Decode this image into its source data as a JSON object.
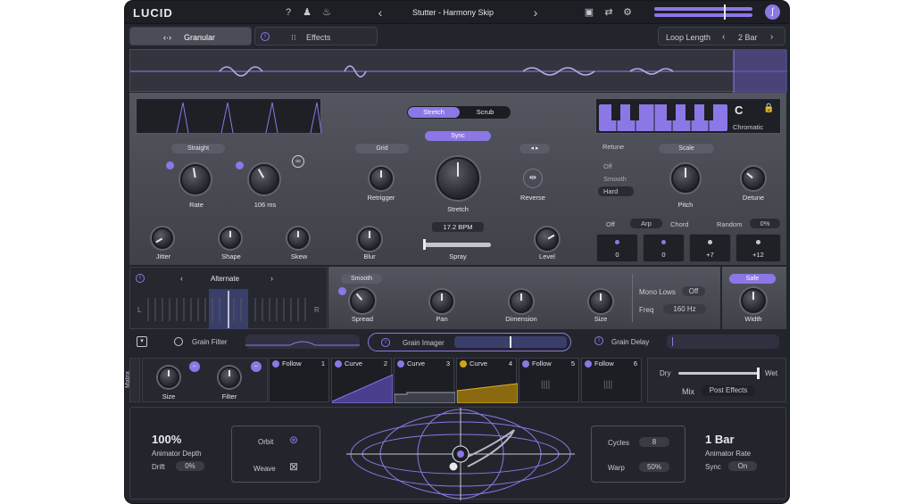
{
  "app": {
    "logo": "LUCID"
  },
  "header": {
    "preset": "Stutter - Harmony Skip",
    "help": "?",
    "prev": "‹",
    "next": "›"
  },
  "tabs": {
    "granular": "Granular",
    "effects": "Effects"
  },
  "loop": {
    "label": "Loop Length",
    "value": "2 Bar"
  },
  "left": {
    "mode": "Straight",
    "rate": "Rate",
    "rate_val": "106 ms",
    "jitter": "Jitter",
    "shape": "Shape",
    "skew": "Skew"
  },
  "center": {
    "stretch_tab": "Stretch",
    "scrub_tab": "Scrub",
    "sync": "Sync",
    "grid": "Grid",
    "retrigger": "Retrigger",
    "stretch": "Stretch",
    "reverse": "Reverse",
    "bpm": "17.2 BPM",
    "blur": "Blur",
    "spray": "Spray",
    "level": "Level"
  },
  "right": {
    "note": "C",
    "scale_name": "Chromatic",
    "retune": "Retune",
    "scale": "Scale",
    "off": "Off",
    "smooth": "Smooth",
    "hard": "Hard",
    "pitch": "Pitch",
    "detune": "Detune",
    "arp_off": "Off",
    "arp": "Arp",
    "chord": "Chord",
    "random": "Random",
    "random_val": "0%",
    "cells": [
      "0",
      "0",
      "+7",
      "+12"
    ]
  },
  "stereo": {
    "mode": "Alternate",
    "L": "L",
    "R": "R",
    "smooth": "Smooth",
    "spread": "Spread",
    "pan": "Pan",
    "dimension": "Dimension",
    "size": "Size",
    "mono_lows": "Mono Lows",
    "mono_val": "Off",
    "freq": "Freq",
    "freq_val": "160 Hz",
    "safe": "Safe",
    "width": "Width"
  },
  "fx": {
    "grain_filter": "Grain Filter",
    "grain_imager": "Grain Imager",
    "grain_delay": "Grain Delay"
  },
  "matrix": {
    "label": "Matrix",
    "size": "Size",
    "filter": "Filter",
    "mods": [
      {
        "name": "Follow",
        "n": "1"
      },
      {
        "name": "Curve",
        "n": "2"
      },
      {
        "name": "Curve",
        "n": "3"
      },
      {
        "name": "Curve",
        "n": "4"
      },
      {
        "name": "Follow",
        "n": "5"
      },
      {
        "name": "Follow",
        "n": "6"
      }
    ],
    "dry": "Dry",
    "wet": "Wet",
    "mix": "Mix",
    "post": "Post Effects"
  },
  "animator": {
    "depth": "100%",
    "depth_label": "Animator Depth",
    "drift": "Drift",
    "drift_val": "0%",
    "orbit": "Orbit",
    "weave": "Weave",
    "cycles": "Cycles",
    "cycles_val": "8",
    "warp": "Warp",
    "warp_val": "50%",
    "rate": "1 Bar",
    "rate_label": "Animator Rate",
    "sync": "Sync",
    "sync_val": "On"
  },
  "colors": {
    "accent": "#8c77e6",
    "bg": "#23252d"
  }
}
